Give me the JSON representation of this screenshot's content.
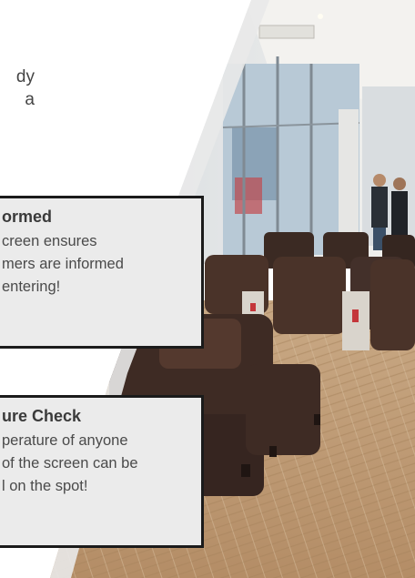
{
  "intro": {
    "lines": [
      "dy",
      "a"
    ]
  },
  "cards": [
    {
      "title": "ormed",
      "lines": [
        "creen ensures",
        "mers are informed",
        " entering!"
      ]
    },
    {
      "title": "ure Check",
      "lines": [
        "perature of anyone",
        "of the screen can be",
        "l on the spot!"
      ]
    }
  ],
  "colors": {
    "card_bg": "#ebebeb",
    "card_border": "#1b1b1b",
    "text": "#444444"
  }
}
